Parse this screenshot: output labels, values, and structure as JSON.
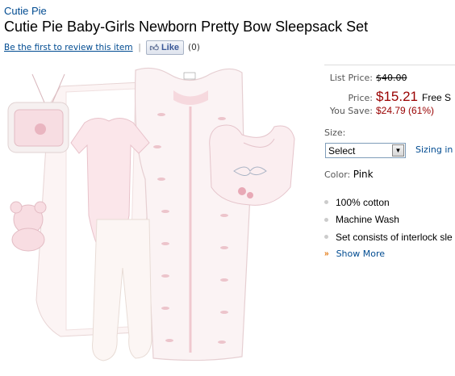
{
  "header": {
    "brand": "Cutie Pie",
    "title": "Cutie Pie Baby-Girls Newborn Pretty Bow Sleepsack Set",
    "review_link": "Be the first to review this item",
    "separator": "|",
    "like_label": "Like",
    "like_count": "(0)"
  },
  "pricing": {
    "list_label": "List Price:",
    "list_value": "$40.00",
    "price_label": "Price:",
    "price_value": "$15.21",
    "free_text": "Free S",
    "save_label": "You Save:",
    "save_value": "$24.79 (61%)"
  },
  "size": {
    "label": "Size:",
    "selected": "Select",
    "sizing_link": "Sizing in"
  },
  "color": {
    "label": "Color:",
    "value": "Pink"
  },
  "features": [
    "100% cotton",
    "Machine Wash",
    "Set consists of interlock sle"
  ],
  "show_more": "Show More",
  "colors": {
    "link": "#004b91",
    "price": "#990000",
    "accent": "#e47911"
  }
}
